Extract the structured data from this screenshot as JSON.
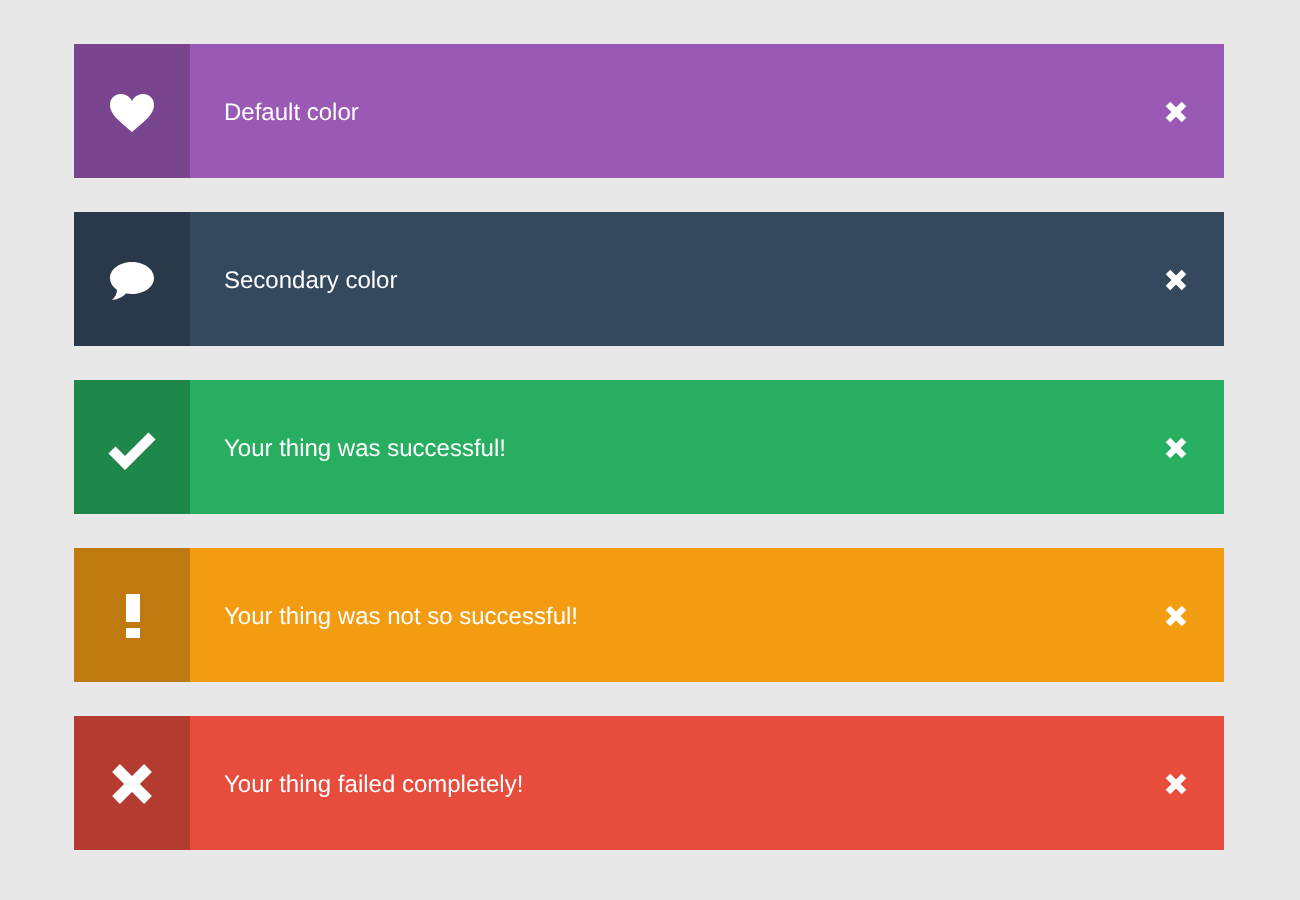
{
  "alerts": [
    {
      "kind": "heart",
      "color": "#9b59b6",
      "message": "Default color"
    },
    {
      "kind": "chat",
      "color": "#34495e",
      "message": "Secondary color"
    },
    {
      "kind": "check",
      "color": "#27ae60",
      "message": "Your thing was successful!"
    },
    {
      "kind": "warning",
      "color": "#f39c12",
      "message": "Your thing was not so successful!"
    },
    {
      "kind": "error",
      "color": "#e74c3c",
      "message": "Your thing failed completely!"
    }
  ]
}
